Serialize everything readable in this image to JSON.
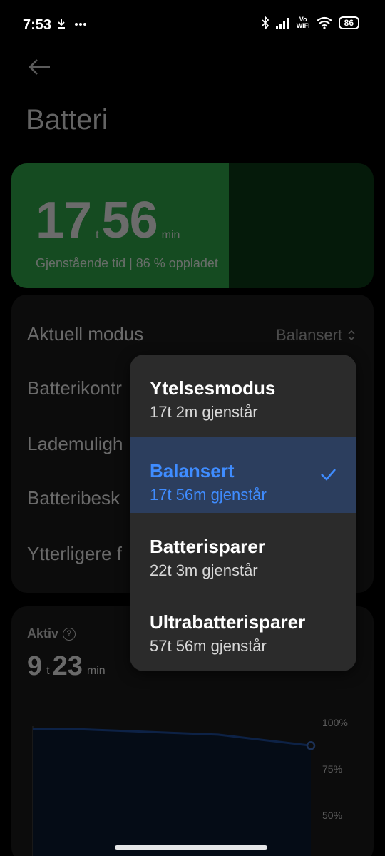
{
  "status_bar": {
    "time": "7:53",
    "battery": "86",
    "volte_top": "Vo",
    "volte_bottom": "WiFi"
  },
  "header": {
    "title": "Batteri"
  },
  "battery_card": {
    "hours": "17",
    "hours_unit": "t",
    "minutes": "56",
    "minutes_unit": "min",
    "subtitle": "Gjenstående tid | 86 % oppladet",
    "charge_fraction": 0.6
  },
  "settings": {
    "mode_label": "Aktuell modus",
    "mode_value": "Balansert",
    "rows": [
      "Batterikontr",
      "Lademuligh",
      "Batteribesk",
      "Ytterligere f"
    ]
  },
  "activity": {
    "label": "Aktiv",
    "hours": "9",
    "hours_unit": "t",
    "minutes": "23",
    "minutes_unit": "min"
  },
  "chart_data": {
    "type": "area",
    "y_tick_labels": [
      "100%",
      "75%",
      "50%"
    ],
    "values": [
      96,
      96,
      95,
      94,
      93,
      90,
      87
    ],
    "ylim": [
      40,
      100
    ],
    "series_color": "#1f4c9c"
  },
  "dropdown": {
    "options": [
      {
        "title": "Ytelsesmodus",
        "subtitle": "17t 2m gjenstår",
        "selected": false
      },
      {
        "title": "Balansert",
        "subtitle": "17t 56m gjenstår",
        "selected": true
      },
      {
        "title": "Batterisparer",
        "subtitle": "22t 3m gjenstår",
        "selected": false
      },
      {
        "title": "Ultrabatterisparer",
        "subtitle": "57t 56m gjenstår",
        "selected": false
      }
    ]
  },
  "colors": {
    "accent": "#3f8cff",
    "battery_green": "#2fa84a",
    "selected_bg": "#2c3e5e"
  }
}
